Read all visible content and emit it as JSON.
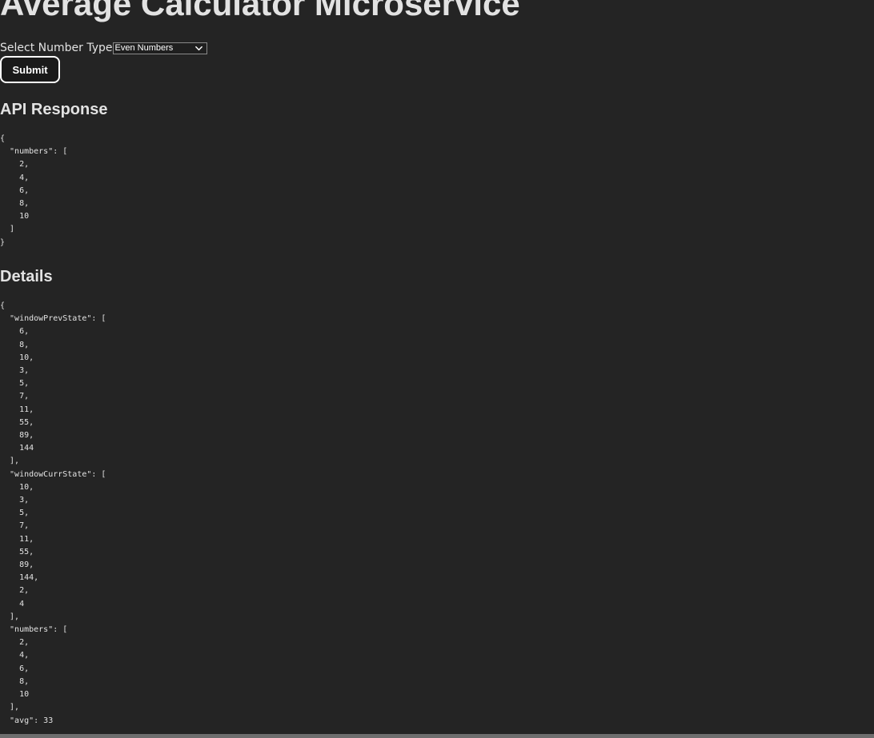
{
  "page": {
    "title": "Average Calculator Microservice"
  },
  "form": {
    "select_label": "Select Number Type",
    "select_value": "Even Numbers",
    "submit_label": "Submit"
  },
  "api_response": {
    "heading": "API Response",
    "json": "{\n  \"numbers\": [\n    2,\n    4,\n    6,\n    8,\n    10\n  ]\n}"
  },
  "details": {
    "heading": "Details",
    "json": "{\n  \"windowPrevState\": [\n    6,\n    8,\n    10,\n    3,\n    5,\n    7,\n    11,\n    55,\n    89,\n    144\n  ],\n  \"windowCurrState\": [\n    10,\n    3,\n    5,\n    7,\n    11,\n    55,\n    89,\n    144,\n    2,\n    4\n  ],\n  \"numbers\": [\n    2,\n    4,\n    6,\n    8,\n    10\n  ],\n  \"avg\": 33"
  },
  "icons": {
    "select_arrow": "chevron-down-icon"
  },
  "colors": {
    "background": "#242424",
    "text": "#dedede",
    "button_border": "#ffffff"
  }
}
